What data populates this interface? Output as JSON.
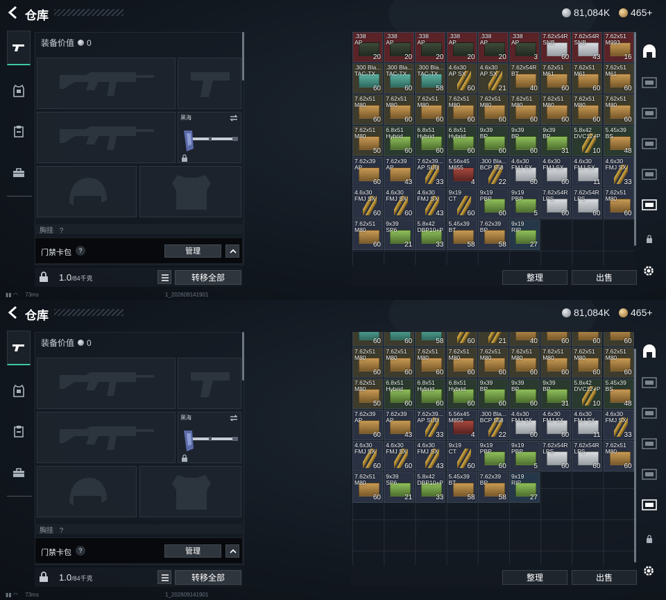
{
  "header": {
    "title": "仓库",
    "currency_silver": "81,084K",
    "currency_gold": "465+"
  },
  "equip": {
    "value_label": "装备价值",
    "value": "0",
    "melee_slot_label": "黑海",
    "cut_row_label": "胸挂",
    "cut_row_icon": "?"
  },
  "card_bar": {
    "label": "门禁卡包",
    "help": "?",
    "manage": "管理"
  },
  "weight_row": {
    "value": "1.0",
    "capacity": "/84千克",
    "transfer_all": "转移全部"
  },
  "inventory": {
    "sort": "整理",
    "sell": "出售",
    "items": [
      {
        "n1": ".338",
        "n2": "AP",
        "q": "20",
        "c": "#5a2328",
        "i": "crate"
      },
      {
        "n1": ".338",
        "n2": "AP",
        "q": "20",
        "c": "#5a2328",
        "i": "crate"
      },
      {
        "n1": ".338",
        "n2": "AP",
        "q": "20",
        "c": "#5a2328",
        "i": "crate"
      },
      {
        "n1": ".338",
        "n2": "AP",
        "q": "20",
        "c": "#5a2328",
        "i": "crate"
      },
      {
        "n1": ".338",
        "n2": "AP",
        "q": "20",
        "c": "#5a2328",
        "i": "crate"
      },
      {
        "n1": ".338",
        "n2": "AP",
        "q": "3",
        "c": "#5a2328",
        "i": "crate"
      },
      {
        "n1": "7.62x54R",
        "n2": "SNB",
        "q": "60",
        "c": "#5a2328",
        "i": "white"
      },
      {
        "n1": "7.62x54R",
        "n2": "SNB",
        "q": "43",
        "c": "#5a2328",
        "i": "white"
      },
      {
        "n1": "7.62x51",
        "n2": "M993",
        "q": "16",
        "c": "#5a2328",
        "i": "tan"
      },
      {
        "n1": ".300 Bla...",
        "n2": "TAC-TX",
        "q": "60",
        "c": "#3d3b2c",
        "i": "teal"
      },
      {
        "n1": ".300 Bla...",
        "n2": "TAC-TX",
        "q": "60",
        "c": "#3d3b2c",
        "i": "teal"
      },
      {
        "n1": ".300 Bla...",
        "n2": "TAC-TX",
        "q": "58",
        "c": "#3d3b2c",
        "i": "teal"
      },
      {
        "n1": "4.6x30",
        "n2": "AP SX",
        "q": "60",
        "c": "#3d3b2c",
        "i": "rnd"
      },
      {
        "n1": "4.6x30",
        "n2": "AP SX",
        "q": "21",
        "c": "#3d3b2c",
        "i": "rnd"
      },
      {
        "n1": "7.62x54R",
        "n2": "BT",
        "q": "40",
        "c": "#3d3b2c",
        "i": "tan"
      },
      {
        "n1": "7.62x51",
        "n2": "M61",
        "q": "60",
        "c": "#3d3b2c",
        "i": "tan"
      },
      {
        "n1": "7.62x51",
        "n2": "M61",
        "q": "60",
        "c": "#3d3b2c",
        "i": "tan"
      },
      {
        "n1": "7.62x51",
        "n2": "M61",
        "q": "60",
        "c": "#3d3b2c",
        "i": "tan"
      },
      {
        "n1": "7.62x51",
        "n2": "M80",
        "q": "60",
        "c": "#3d3b2c",
        "i": "tan"
      },
      {
        "n1": "7.62x51",
        "n2": "M80",
        "q": "60",
        "c": "#3d3b2c",
        "i": "tan"
      },
      {
        "n1": "7.62x51",
        "n2": "M80",
        "q": "60",
        "c": "#3d3b2c",
        "i": "tan"
      },
      {
        "n1": "7.62x51",
        "n2": "M80",
        "q": "60",
        "c": "#3d3b2c",
        "i": "tan"
      },
      {
        "n1": "7.62x51",
        "n2": "M80",
        "q": "60",
        "c": "#3d3b2c",
        "i": "tan"
      },
      {
        "n1": "7.62x51",
        "n2": "M80",
        "q": "60",
        "c": "#3d3b2c",
        "i": "tan"
      },
      {
        "n1": "7.62x51",
        "n2": "M80",
        "q": "60",
        "c": "#3d3b2c",
        "i": "tan"
      },
      {
        "n1": "7.62x51",
        "n2": "M80",
        "q": "60",
        "c": "#3d3b2c",
        "i": "tan"
      },
      {
        "n1": "7.62x51",
        "n2": "M80",
        "q": "60",
        "c": "#3d3b2c",
        "i": "tan"
      },
      {
        "n1": "7.62x51",
        "n2": "M80",
        "q": "50",
        "c": "#3d3b2c",
        "i": "tan"
      },
      {
        "n1": "6.8x51",
        "n2": "Hybrid",
        "q": "60",
        "c": "#2a3a2e",
        "i": "green"
      },
      {
        "n1": "6.8x51",
        "n2": "Hybrid",
        "q": "60",
        "c": "#2a3a2e",
        "i": "green"
      },
      {
        "n1": "6.8x51",
        "n2": "Hybrid",
        "q": "60",
        "c": "#2a3a2e",
        "i": "green"
      },
      {
        "n1": "9x39",
        "n2": "BP",
        "q": "60",
        "c": "#2a3a2e",
        "i": "green"
      },
      {
        "n1": "9x39",
        "n2": "BP",
        "q": "60",
        "c": "#2a3a2e",
        "i": "green"
      },
      {
        "n1": "9x39",
        "n2": "BP",
        "q": "31",
        "c": "#2a3a2e",
        "i": "green"
      },
      {
        "n1": "5.8x42",
        "n2": "DVC12+P",
        "q": "10",
        "c": "#2a3a2e",
        "i": "rnd"
      },
      {
        "n1": "5.45x39",
        "n2": "BS",
        "q": "48",
        "c": "#2a3a2e",
        "i": "tan"
      },
      {
        "n1": "7.62x39",
        "n2": "AP",
        "q": "60",
        "c": "#2a3142",
        "i": "tan"
      },
      {
        "n1": "7.62x39",
        "n2": "AP",
        "q": "43",
        "c": "#2a3142",
        "i": "tan"
      },
      {
        "n1": "7.62x39...",
        "n2": "AP SUB",
        "q": "33",
        "c": "#2a3142",
        "i": "rnd"
      },
      {
        "n1": "5.56x45",
        "n2": "M855",
        "q": "4",
        "c": "#2a3142",
        "i": "red"
      },
      {
        "n1": ".300 Bla...",
        "n2": "BCP 558",
        "q": "22",
        "c": "#2a3142",
        "i": "rnd"
      },
      {
        "n1": "4.6x30",
        "n2": "FMJ SX",
        "q": "60",
        "c": "#2a3142",
        "i": "white"
      },
      {
        "n1": "4.6x30",
        "n2": "FMJ SX",
        "q": "60",
        "c": "#2a3142",
        "i": "white"
      },
      {
        "n1": "4.6x30",
        "n2": "FMJ SX",
        "q": "11",
        "c": "#2a3142",
        "i": "white"
      },
      {
        "n1": "4.6x30",
        "n2": "FMJ SX",
        "q": "33",
        "c": "#2a3142",
        "i": "rnd"
      },
      {
        "n1": "4.6x30",
        "n2": "FMJ SX",
        "q": "60",
        "c": "#2a3142",
        "i": "rnd"
      },
      {
        "n1": "4.6x30",
        "n2": "FMJ SX",
        "q": "60",
        "c": "#2a3142",
        "i": "rnd"
      },
      {
        "n1": "4.6x30",
        "n2": "FMJ SX",
        "q": "43",
        "c": "#2a3142",
        "i": "rnd"
      },
      {
        "n1": "9x19",
        "n2": "CT",
        "q": "60",
        "c": "#2a3142",
        "i": "rnd"
      },
      {
        "n1": "9x19",
        "n2": "PBP",
        "q": "60",
        "c": "#2a3142",
        "i": "green"
      },
      {
        "n1": "9x19",
        "n2": "PBP",
        "q": "5",
        "c": "#2a3142",
        "i": "green"
      },
      {
        "n1": "7.62x54R",
        "n2": "LPS",
        "q": "60",
        "c": "#2a3142",
        "i": "white"
      },
      {
        "n1": "7.62x54R",
        "n2": "LPS",
        "q": "60",
        "c": "#2a3142",
        "i": "white"
      },
      {
        "n1": "7.62x51",
        "n2": "M80",
        "q": "60",
        "c": "#2a3142",
        "i": "tan"
      },
      {
        "n1": "7.62x51",
        "n2": "M80",
        "q": "60",
        "c": "#2a3142",
        "i": "tan"
      },
      {
        "n1": "9x39",
        "n2": "SP6",
        "q": "21",
        "c": "#2a3142",
        "i": "green"
      },
      {
        "n1": "5.8x42",
        "n2": "DBP10+P",
        "q": "33",
        "c": "#2a3142",
        "i": "green"
      },
      {
        "n1": "5.45x39",
        "n2": "BT",
        "q": "58",
        "c": "#2a3142",
        "i": "tan"
      },
      {
        "n1": "7.62x39",
        "n2": "BP",
        "q": "58",
        "c": "#2a3142",
        "i": "tan"
      },
      {
        "n1": "9x19",
        "n2": "RIP",
        "q": "27",
        "c": "#25384a",
        "i": "green"
      }
    ]
  },
  "inventory_scrolled": {
    "items": [
      {
        "n1": "",
        "n2": "",
        "q": "60",
        "c": "#3d3b2c",
        "i": "teal"
      },
      {
        "n1": "",
        "n2": "",
        "q": "60",
        "c": "#3d3b2c",
        "i": "teal"
      },
      {
        "n1": "",
        "n2": "",
        "q": "58",
        "c": "#3d3b2c",
        "i": "teal"
      },
      {
        "n1": "",
        "n2": "",
        "q": "60",
        "c": "#3d3b2c",
        "i": "rnd"
      },
      {
        "n1": "",
        "n2": "",
        "q": "21",
        "c": "#3d3b2c",
        "i": "rnd"
      },
      {
        "n1": "",
        "n2": "",
        "q": "40",
        "c": "#3d3b2c",
        "i": "tan"
      },
      {
        "n1": "",
        "n2": "",
        "q": "60",
        "c": "#3d3b2c",
        "i": "tan"
      },
      {
        "n1": "",
        "n2": "",
        "q": "60",
        "c": "#3d3b2c",
        "i": "tan"
      },
      {
        "n1": "",
        "n2": "",
        "q": "60",
        "c": "#3d3b2c",
        "i": "tan"
      }
    ]
  },
  "status": {
    "ping": "73ms",
    "build": "1_202609141901"
  },
  "colors": {
    "accent": "#3ec9a7",
    "panel": "#161c24",
    "button": "#2f353d"
  }
}
